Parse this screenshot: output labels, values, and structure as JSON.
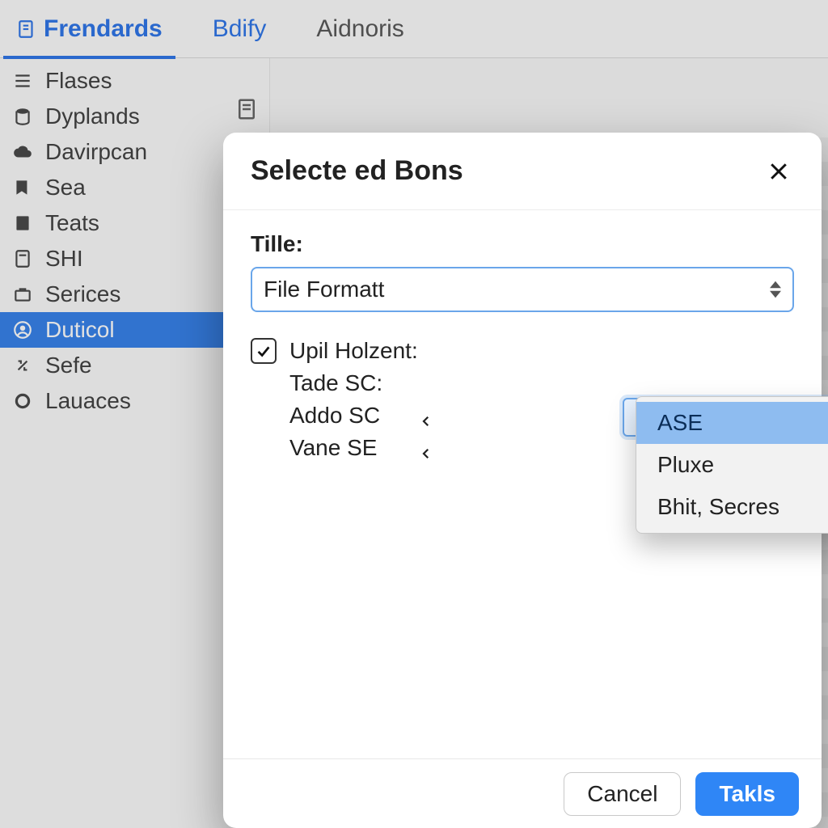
{
  "tabs": {
    "active": "Frendards",
    "items": [
      "Frendards",
      "Bdify",
      "Aidnoris"
    ]
  },
  "sidebar": {
    "items": [
      {
        "label": "Flases",
        "icon": "list-icon"
      },
      {
        "label": "Dyplands",
        "icon": "cylinder-icon"
      },
      {
        "label": "Davirpcan",
        "icon": "cloud-icon"
      },
      {
        "label": "Sea",
        "icon": "bookmark-icon"
      },
      {
        "label": "Teats",
        "icon": "book-icon"
      },
      {
        "label": "SHI",
        "icon": "calculator-icon"
      },
      {
        "label": "Serices",
        "icon": "briefcase-icon"
      },
      {
        "label": "Duticol",
        "icon": "circle-user-icon",
        "selected": true
      },
      {
        "label": "Sefe",
        "icon": "arrows-icon",
        "checked": true
      },
      {
        "label": "Lauaces",
        "icon": "ring-icon"
      }
    ]
  },
  "dialog": {
    "title": "Selecte ed Bons",
    "field_label": "Tille:",
    "field_value": "File Formatt",
    "checkbox_checked": true,
    "checkbox_label": "Upil Holzent:",
    "rows": {
      "r1": "Tade SC:",
      "r2": "Addo SC",
      "r3": "Vane SE"
    },
    "dropdown_options": [
      "ASE",
      "Pluxe",
      "Bhit, Secres"
    ],
    "dropdown_hover_index": 0,
    "footer": {
      "cancel": "Cancel",
      "confirm": "Takls"
    }
  }
}
